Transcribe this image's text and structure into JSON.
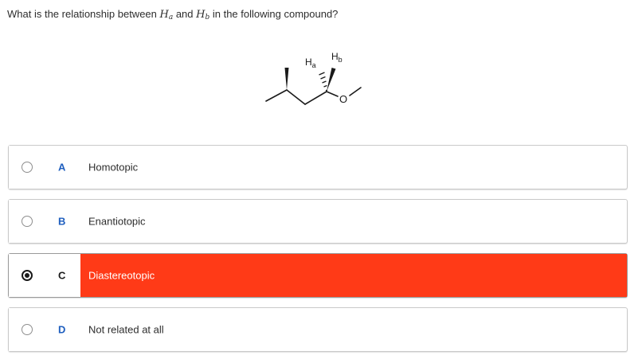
{
  "question": {
    "prefix": "What is the relationship between ",
    "var_a": "H",
    "var_a_sub": "a",
    "middle": " and ",
    "var_b": "H",
    "var_b_sub": "b",
    "suffix": " in the following compound?"
  },
  "structure": {
    "label_a": "Ha",
    "label_b": "Hb",
    "label_o": "O"
  },
  "options": [
    {
      "letter": "A",
      "label": "Homotopic",
      "selected": false
    },
    {
      "letter": "B",
      "label": "Enantiotopic",
      "selected": false
    },
    {
      "letter": "C",
      "label": "Diastereotopic",
      "selected": true
    },
    {
      "letter": "D",
      "label": "Not related at all",
      "selected": false
    }
  ],
  "colors": {
    "selected_bg": "#ff3a17",
    "letter_color": "#1f5fbf"
  }
}
